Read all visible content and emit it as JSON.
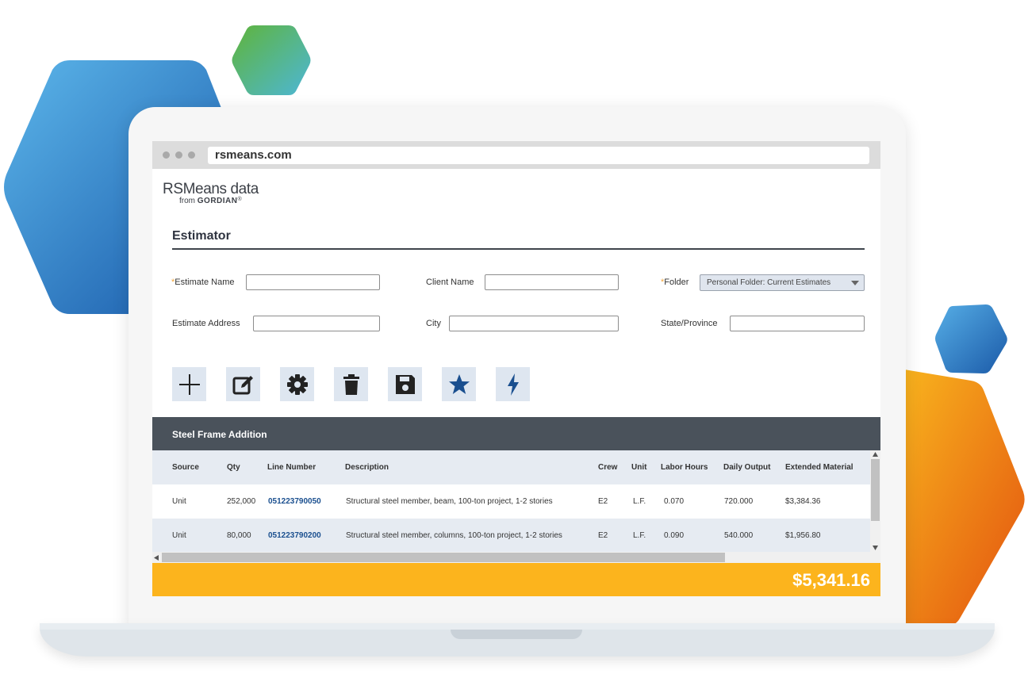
{
  "browser": {
    "url": "rsmeans.com"
  },
  "brand": {
    "logo_main": "RSMeans data",
    "logo_from": "from",
    "logo_company": "GORDIAN",
    "logo_mark": "®"
  },
  "page": {
    "title": "Estimator"
  },
  "form": {
    "required_mark": "*",
    "estimate_name_label": "Estimate Name",
    "estimate_name_value": "",
    "client_name_label": "Client Name",
    "client_name_value": "",
    "folder_label": "Folder",
    "folder_value": "Personal Folder: Current Estimates",
    "estimate_address_label": "Estimate Address",
    "estimate_address_value": "",
    "city_label": "City",
    "city_value": "",
    "state_label": "State/Province",
    "state_value": ""
  },
  "toolbar": {
    "icons": [
      "plus-icon",
      "edit-icon",
      "gear-icon",
      "trash-icon",
      "save-icon",
      "star-icon",
      "lightning-icon"
    ],
    "icon_color": "#1a4f8f"
  },
  "section": {
    "title": "Steel Frame Addition"
  },
  "table": {
    "headers": [
      "Source",
      "Qty",
      "Line Number",
      "Description",
      "Crew",
      "Unit",
      "Labor Hours",
      "Daily Output",
      "Extended Material"
    ],
    "rows": [
      [
        "Unit",
        "252,000",
        "051223790050",
        "Structural steel member, beam, 100-ton project, 1-2 stories",
        "E2",
        "L.F.",
        "0.070",
        "720.000",
        "$3,384.36"
      ],
      [
        "Unit",
        "80,000",
        "051223790200",
        "Structural steel member, columns, 100-ton project, 1-2 stories",
        "E2",
        "L.F.",
        "0.090",
        "540.000",
        "$1,956.80"
      ]
    ]
  },
  "summary": {
    "total": "$5,341.16"
  },
  "colors": {
    "accent_yellow": "#fcb41d",
    "header_dark": "#4a525b",
    "link_blue": "#1a4f8f"
  }
}
